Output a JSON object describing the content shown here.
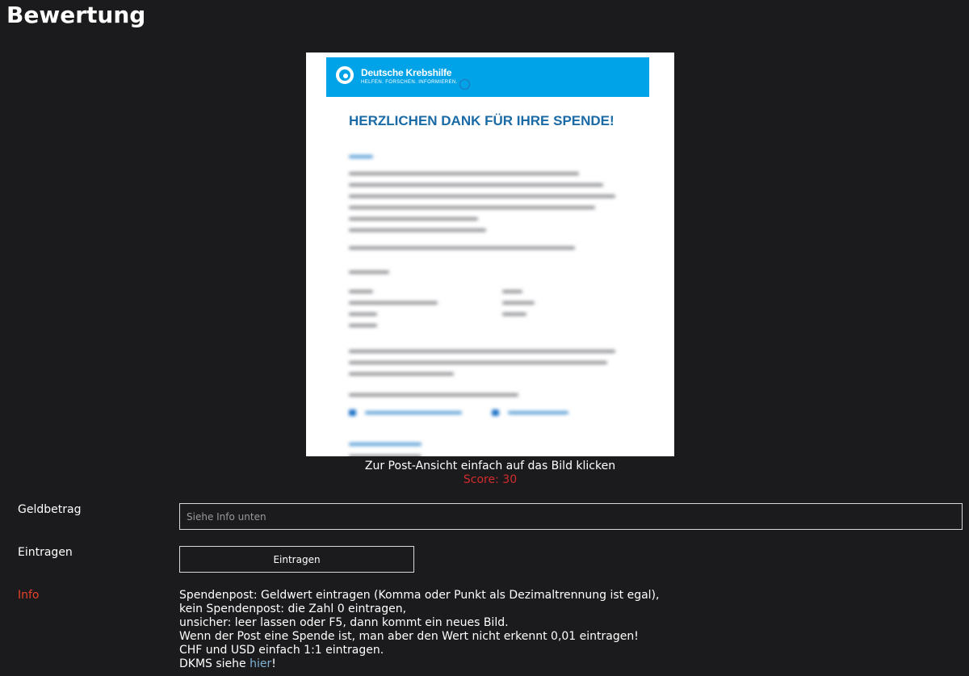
{
  "page": {
    "title": "Bewertung"
  },
  "post": {
    "brand_name": "Deutsche Krebshilfe",
    "brand_tagline": "HELFEN. FORSCHEN. INFORMIEREN.",
    "headline": "HERZLICHEN DANK FÜR IHRE SPENDE!",
    "caption": "Zur Post-Ansicht einfach auf das Bild klicken",
    "score_label": "Score:",
    "score_value": "30"
  },
  "form": {
    "amount_label": "Geldbetrag",
    "amount_placeholder": "Siehe Info unten",
    "amount_value": "",
    "submit_row_label": "Eintragen",
    "submit_button_label": "Eintragen",
    "info_label": "Info",
    "info_lines": [
      "Spendenpost: Geldwert eintragen (Komma oder Punkt als Dezimaltrennung ist egal),",
      "kein Spendenpost: die Zahl 0 eintragen,",
      "unsicher: leer lassen oder F5, dann kommt ein neues Bild.",
      "Wenn der Post eine Spende ist, man aber den Wert nicht erkennt 0,01 eintragen!",
      "CHF und USD einfach 1:1 eintragen."
    ],
    "dkms_prefix": "DKMS siehe ",
    "dkms_link": "hier",
    "dkms_suffix": "!"
  },
  "colors": {
    "background": "#1b1b1d",
    "score": "#d32c2c",
    "info_label": "#e8432a",
    "link": "#7fb3d5",
    "brand_header": "#00a3e8",
    "brand_headline": "#1a6aa6"
  }
}
